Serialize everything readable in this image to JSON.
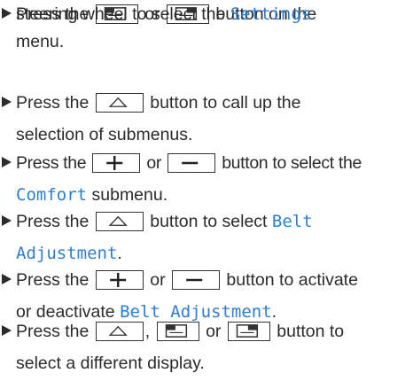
{
  "steps": [
    {
      "pre": "Press the",
      "mid1": "or",
      "post": "button on the",
      "line2a": "steering wheel to select the",
      "hl": "Settings",
      "line3": "menu.",
      "icons": [
        "page-back-icon",
        "page-forward-icon"
      ]
    },
    {
      "pre": "Press the",
      "post": "button to call up the",
      "line2": "selection of submenus.",
      "icons": [
        "up-triangle-icon"
      ]
    },
    {
      "pre": "Press the",
      "mid1": "or",
      "post": "button to select the",
      "hl": "Comfort",
      "line2": "submenu.",
      "icons": [
        "plus-icon",
        "minus-icon"
      ]
    },
    {
      "pre": "Press the",
      "post": "button to select",
      "hl_a": "Belt",
      "hl_b": "Adjustment",
      "end": ".",
      "icons": [
        "up-triangle-icon"
      ]
    },
    {
      "pre": "Press the",
      "mid1": "or",
      "post": "button to activate",
      "line2": "or deactivate",
      "hl": "Belt Adjustment",
      "end": ".",
      "icons": [
        "plus-icon",
        "minus-icon"
      ]
    },
    {
      "pre": "Press the",
      "comma": ",",
      "mid1": "or",
      "post": "button to",
      "line2": "select a different display.",
      "icons": [
        "up-triangle-icon",
        "page-back-icon",
        "page-forward-icon"
      ]
    }
  ],
  "colors": {
    "text": "#2b2b2b",
    "highlight": "#2e7dd1"
  }
}
